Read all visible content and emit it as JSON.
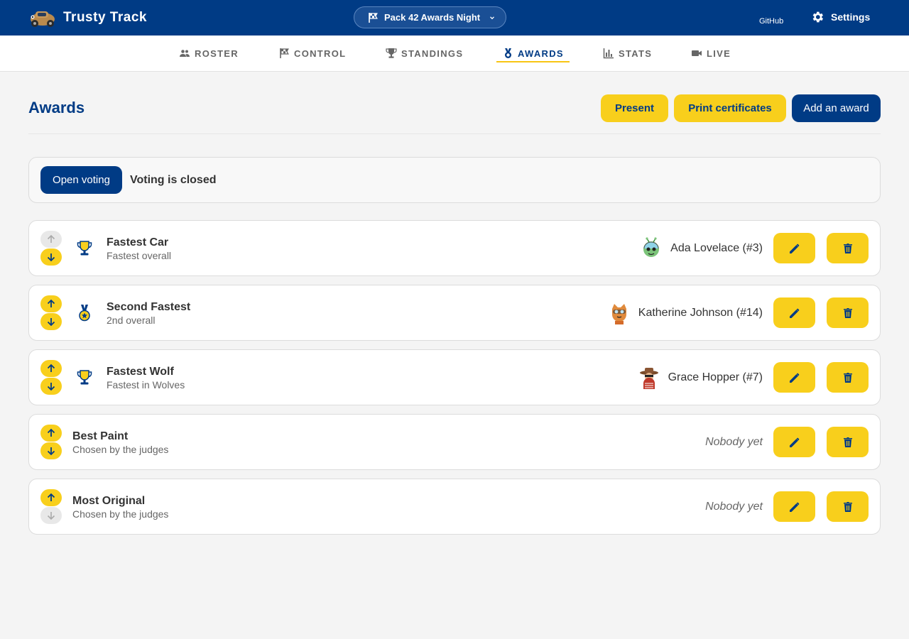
{
  "app": {
    "name": "Trusty Track"
  },
  "event": {
    "name": "Pack 42 Awards Night"
  },
  "header_links": {
    "github": "GitHub",
    "settings": "Settings"
  },
  "nav": {
    "tabs": [
      {
        "label": "ROSTER",
        "icon": "people-icon",
        "active": false
      },
      {
        "label": "CONTROL",
        "icon": "flag-icon",
        "active": false
      },
      {
        "label": "STANDINGS",
        "icon": "trophy-icon",
        "active": false
      },
      {
        "label": "AWARDS",
        "icon": "medal-icon",
        "active": true
      },
      {
        "label": "STATS",
        "icon": "bar-chart-icon",
        "active": false
      },
      {
        "label": "LIVE",
        "icon": "video-camera-icon",
        "active": false
      }
    ]
  },
  "page": {
    "title": "Awards",
    "buttons": {
      "present": "Present",
      "print": "Print certificates",
      "add": "Add an award"
    }
  },
  "voting": {
    "button": "Open voting",
    "status": "Voting is closed"
  },
  "awards": [
    {
      "name": "Fastest Car",
      "description": "Fastest overall",
      "icon": "trophy-icon",
      "winner": "Ada Lovelace (#3)",
      "avatar": "alien-avatar",
      "can_move_up": false,
      "can_move_down": true
    },
    {
      "name": "Second Fastest",
      "description": "2nd overall",
      "icon": "medal-icon",
      "winner": "Katherine Johnson (#14)",
      "avatar": "cat-pilot-avatar",
      "can_move_up": true,
      "can_move_down": true
    },
    {
      "name": "Fastest Wolf",
      "description": "Fastest in Wolves",
      "icon": "trophy-icon",
      "winner": "Grace Hopper (#7)",
      "avatar": "cowboy-avatar",
      "can_move_up": true,
      "can_move_down": true
    },
    {
      "name": "Best Paint",
      "description": "Chosen by the judges",
      "icon": "",
      "winner": "Nobody yet",
      "avatar": "",
      "can_move_up": true,
      "can_move_down": true
    },
    {
      "name": "Most Original",
      "description": "Chosen by the judges",
      "icon": "",
      "winner": "Nobody yet",
      "avatar": "",
      "can_move_up": true,
      "can_move_down": false
    }
  ],
  "colors": {
    "primary": "#003b85",
    "accent": "#f8cf1c",
    "background": "#f4f4f4"
  }
}
